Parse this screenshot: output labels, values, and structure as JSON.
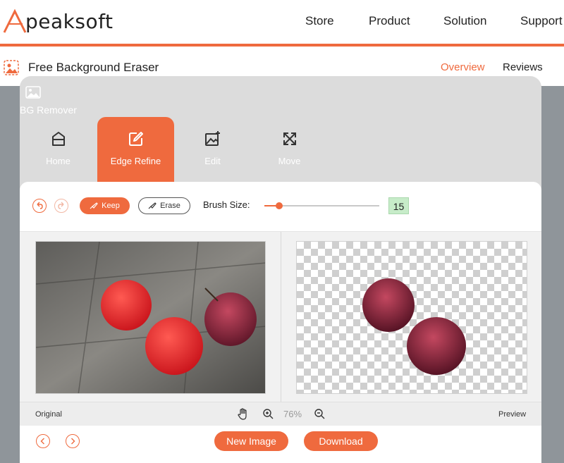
{
  "brand": {
    "logo_text": "peaksoft",
    "accent": "#ef6a3e"
  },
  "nav": {
    "items": [
      "Store",
      "Product",
      "Solution",
      "Support"
    ]
  },
  "subheader": {
    "title": "Free Background Eraser",
    "links": [
      "Overview",
      "Reviews"
    ],
    "active": "Overview"
  },
  "app": {
    "bg_remover_label": "BG Remover",
    "tabs": [
      {
        "label": "Home",
        "icon": "home-icon"
      },
      {
        "label": "Edge Refine",
        "icon": "edit-square-icon",
        "active": true
      },
      {
        "label": "Edit",
        "icon": "image-edit-icon"
      },
      {
        "label": "Move",
        "icon": "move-icon"
      }
    ],
    "toolbar": {
      "keep_label": "Keep",
      "erase_label": "Erase",
      "brush_label": "Brush Size:",
      "brush_value": "15",
      "brush_level": 0.13
    },
    "canvas": {
      "original_label": "Original",
      "preview_label": "Preview",
      "zoom": "76%"
    },
    "footer": {
      "new_image_label": "New Image",
      "download_label": "Download"
    }
  }
}
